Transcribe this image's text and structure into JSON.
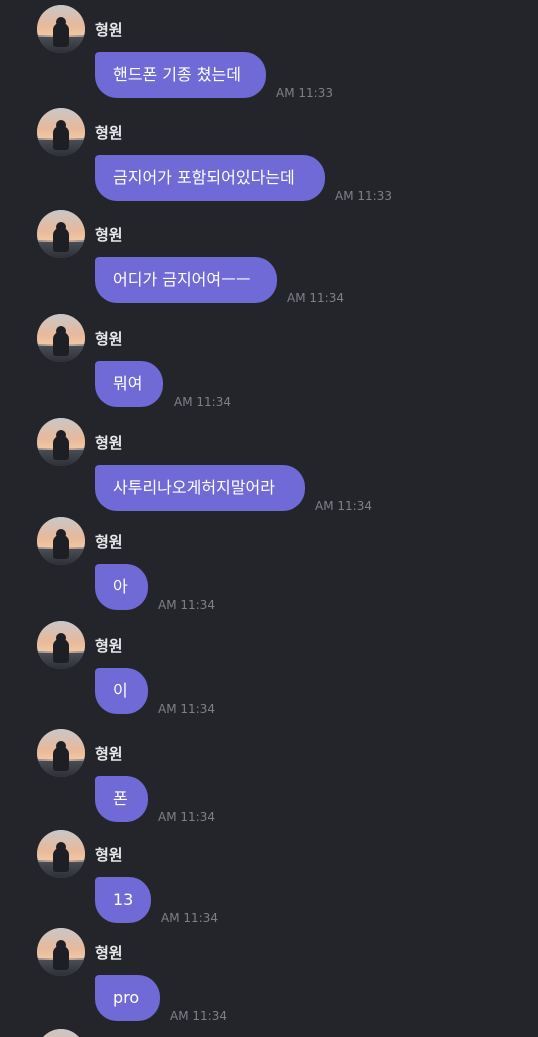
{
  "messages": [
    {
      "sender": "형원",
      "text": "핸드폰 기종 쳤는데",
      "time": "AM 11:33"
    },
    {
      "sender": "형원",
      "text": "금지어가 포함되어있다는데",
      "time": "AM 11:33"
    },
    {
      "sender": "형원",
      "text": "어디가 금지어여ㅡㅡ",
      "time": "AM 11:34"
    },
    {
      "sender": "형원",
      "text": "뭐여",
      "time": "AM 11:34"
    },
    {
      "sender": "형원",
      "text": "사투리나오게허지말어라",
      "time": "AM 11:34"
    },
    {
      "sender": "형원",
      "text": "아",
      "time": "AM 11:34"
    },
    {
      "sender": "형원",
      "text": "이",
      "time": "AM 11:34"
    },
    {
      "sender": "형원",
      "text": "폰",
      "time": "AM 11:34"
    },
    {
      "sender": "형원",
      "text": "13",
      "time": "AM 11:34"
    },
    {
      "sender": "형원",
      "text": "pro",
      "time": "AM 11:34"
    }
  ],
  "colors": {
    "background": "#24252a",
    "bubble": "#6f6ad6",
    "timestamp": "#7f8087"
  }
}
